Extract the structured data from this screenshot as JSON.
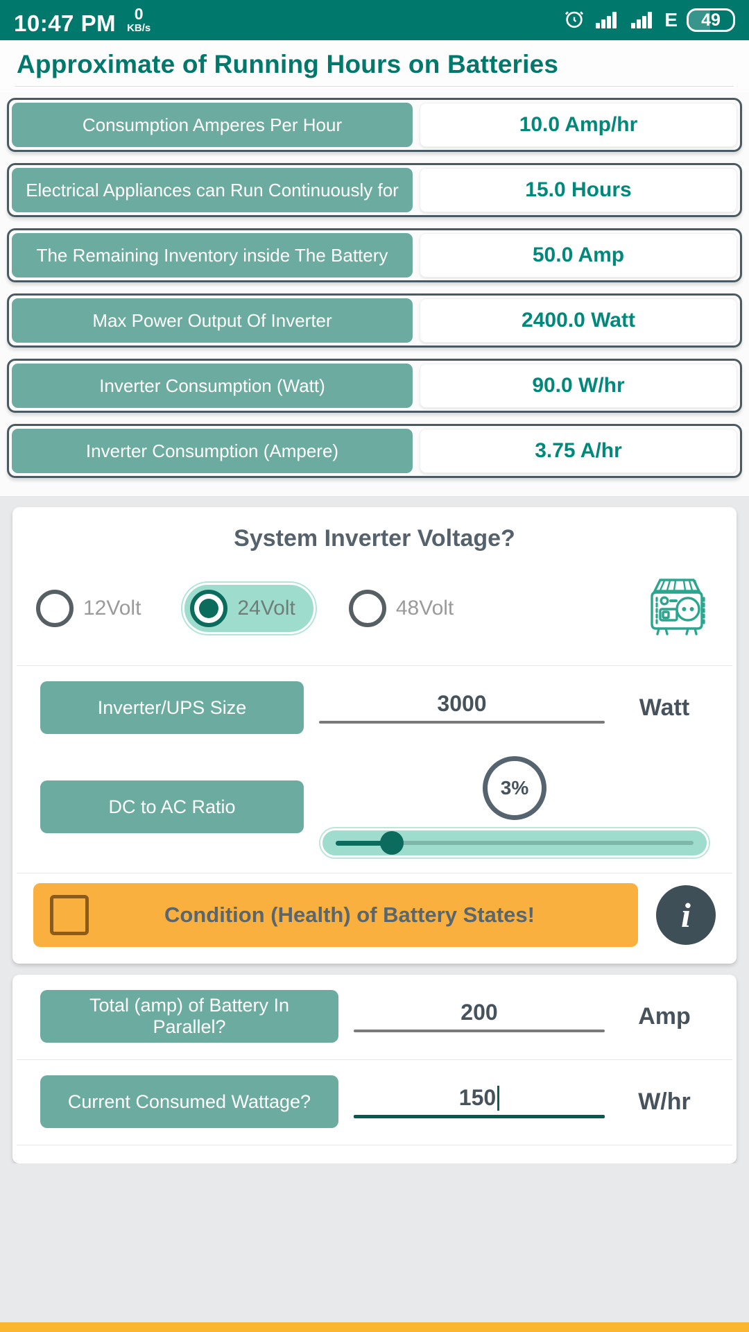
{
  "statusbar": {
    "time": "10:47 PM",
    "net_speed_value": "0",
    "net_speed_unit": "KB/s",
    "alarm_icon": "alarm-clock-icon",
    "signal1_icon": "signal-bars-icon",
    "signal2_icon": "signal-bars-icon",
    "network_type": "E",
    "battery_percent": "49",
    "bg_color": "#00786b"
  },
  "header": {
    "title": "Approximate of Running Hours on Batteries",
    "title_color": "#00786b"
  },
  "results": {
    "label_color": "#6cab9f",
    "value_color": "#00897b",
    "rows": [
      {
        "label": "Consumption Amperes Per Hour",
        "value": "10.0 Amp/hr"
      },
      {
        "label": "Electrical Appliances can Run Continuously for",
        "value": "15.0 Hours"
      },
      {
        "label": "The Remaining Inventory inside The Battery",
        "value": "50.0 Amp"
      },
      {
        "label": "Max Power Output Of Inverter",
        "value": "2400.0 Watt"
      },
      {
        "label": "Inverter Consumption (Watt)",
        "value": "90.0 W/hr"
      },
      {
        "label": "Inverter Consumption (Ampere)",
        "value": "3.75 A/hr"
      }
    ]
  },
  "voltage_card": {
    "title": "System Inverter Voltage?",
    "options": [
      {
        "label": "12Volt",
        "selected": false
      },
      {
        "label": "24Volt",
        "selected": true
      },
      {
        "label": "48Volt",
        "selected": false
      }
    ],
    "icon": "inverter-generator-icon",
    "selected_bg": "#9edccd"
  },
  "inverter_size": {
    "label": "Inverter/UPS Size",
    "value": "3000",
    "unit": "Watt"
  },
  "dc_ac_ratio": {
    "label": "DC to AC Ratio",
    "badge_value": "3%",
    "slider_percent": 3
  },
  "condition": {
    "label": "Condition (Health) of Battery States!",
    "checked": false,
    "bar_color": "#f9b03e",
    "info_icon": "info-icon"
  },
  "battery_card": {
    "rows": [
      {
        "label": "Total (amp) of Battery In Parallel?",
        "value": "200",
        "unit": "Amp",
        "focused": false
      },
      {
        "label": "Current Consumed Wattage?",
        "value": "150",
        "unit": "W/hr",
        "focused": true
      }
    ]
  },
  "footer": {
    "accent_color": "#f9b62e"
  }
}
